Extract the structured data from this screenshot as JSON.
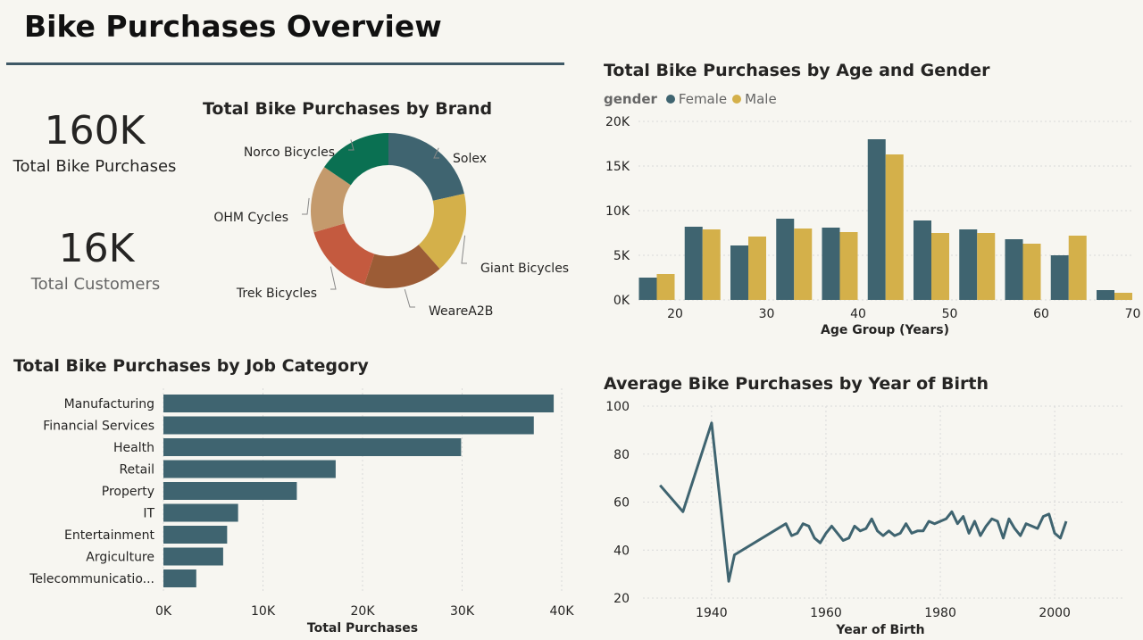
{
  "page": {
    "title": "Bike Purchases Overview"
  },
  "kpis": {
    "total_purchases": {
      "value": "160K",
      "label": "Total Bike Purchases"
    },
    "total_customers": {
      "value": "16K",
      "label": "Total Customers"
    }
  },
  "colors": {
    "female": "#3f6470",
    "male": "#d4b04a",
    "bar": "#3f6470",
    "line": "#3f6470",
    "grid": "#d9d9d9",
    "donut": [
      "#3f6470",
      "#d4b04a",
      "#9c5c36",
      "#c45a3f",
      "#c49a6c",
      "#0a7052"
    ]
  },
  "chart_data": [
    {
      "id": "brand",
      "type": "pie",
      "donut": true,
      "title": "Total Bike Purchases by Brand",
      "categories": [
        "Solex",
        "Giant Bicycles",
        "WeareA2B",
        "Trek Bicycles",
        "OHM Cycles",
        "Norco Bicycles"
      ],
      "values": [
        21.5,
        17.0,
        16.5,
        15.5,
        14.0,
        15.5
      ]
    },
    {
      "id": "age_gender",
      "type": "bar",
      "title": "Total Bike Purchases by Age and Gender",
      "legend_title": "gender",
      "legend_position": "top-left",
      "x": [
        18,
        23,
        28,
        33,
        38,
        43,
        48,
        53,
        58,
        63,
        68
      ],
      "series": [
        {
          "name": "Female",
          "values": [
            2500,
            8200,
            6100,
            9100,
            8100,
            18000,
            8900,
            7900,
            6800,
            5000,
            1100
          ]
        },
        {
          "name": "Male",
          "values": [
            2900,
            7900,
            7100,
            8000,
            7600,
            16300,
            7500,
            7500,
            6300,
            7200,
            800
          ]
        }
      ],
      "xticks": [
        20,
        30,
        40,
        50,
        60,
        70
      ],
      "yticks": [
        "0K",
        "5K",
        "10K",
        "15K",
        "20K"
      ],
      "ylim": [
        0,
        20000
      ],
      "xlabel": "Age Group (Years)",
      "ylabel": "",
      "grid": true
    },
    {
      "id": "job",
      "type": "bar",
      "orientation": "horizontal",
      "title": "Total Bike Purchases by Job Category",
      "categories": [
        "Manufacturing",
        "Financial Services",
        "Health",
        "Retail",
        "Property",
        "IT",
        "Entertainment",
        "Argiculture",
        "Telecommunicatio..."
      ],
      "values": [
        39200,
        37200,
        29900,
        17300,
        13400,
        7500,
        6400,
        6000,
        3300
      ],
      "xticks": [
        "0K",
        "10K",
        "20K",
        "30K",
        "40K"
      ],
      "xlim": [
        0,
        40000
      ],
      "xlabel": "Total Purchases",
      "ylabel": "",
      "grid": true
    },
    {
      "id": "yob",
      "type": "line",
      "title": "Average Bike Purchases by Year of Birth",
      "x": [
        1931,
        1935,
        1940,
        1943,
        1944,
        1953,
        1954,
        1955,
        1956,
        1957,
        1958,
        1959,
        1960,
        1961,
        1962,
        1963,
        1964,
        1965,
        1966,
        1967,
        1968,
        1969,
        1970,
        1971,
        1972,
        1973,
        1974,
        1975,
        1976,
        1977,
        1978,
        1979,
        1980,
        1981,
        1982,
        1983,
        1984,
        1985,
        1986,
        1987,
        1988,
        1989,
        1990,
        1991,
        1992,
        1993,
        1994,
        1995,
        1996,
        1997,
        1998,
        1999,
        2000,
        2001,
        2002
      ],
      "y": [
        67,
        56,
        93,
        27,
        38,
        51,
        46,
        47,
        51,
        50,
        45,
        43,
        47,
        50,
        47,
        44,
        45,
        50,
        48,
        49,
        53,
        48,
        46,
        48,
        46,
        47,
        51,
        47,
        48,
        48,
        52,
        51,
        52,
        53,
        56,
        51,
        54,
        47,
        52,
        46,
        50,
        53,
        52,
        45,
        53,
        49,
        46,
        51,
        50,
        49,
        54,
        55,
        47,
        45,
        52
      ],
      "xticks": [
        1940,
        1960,
        1980,
        2000
      ],
      "yticks": [
        20,
        40,
        60,
        80,
        100
      ],
      "ylim": [
        20,
        100
      ],
      "xlim": [
        1928,
        2012
      ],
      "xlabel": "Year of Birth",
      "ylabel": "",
      "grid": true
    }
  ]
}
